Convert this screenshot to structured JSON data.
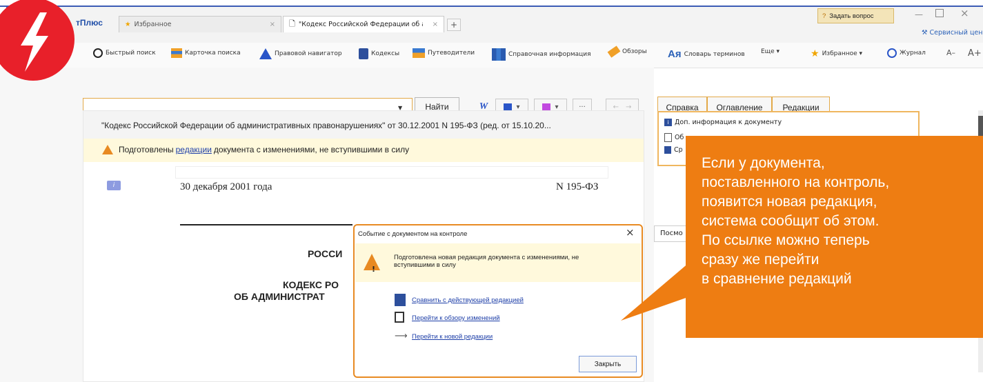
{
  "tabs": [
    {
      "label": "тПлюс"
    },
    {
      "label": "Избранное"
    },
    {
      "label": "\"Кодекс Российской Федерации об а..."
    }
  ],
  "header": {
    "ask_label": "Задать вопрос",
    "service_label": "Сервисный цен"
  },
  "toolbar": {
    "items": [
      {
        "label": "Быстрый поиск",
        "icon": "magnifier-icon"
      },
      {
        "label": "Карточка поиска",
        "icon": "search-card-icon"
      },
      {
        "label": "Правовой навигатор",
        "icon": "navigator-icon"
      },
      {
        "label": "Кодексы",
        "icon": "codex-icon"
      },
      {
        "label": "Путеводители",
        "icon": "signpost-icon"
      },
      {
        "label": "Справочная информация",
        "icon": "reference-icon"
      },
      {
        "label": "Обзоры",
        "icon": "pen-icon"
      },
      {
        "label": "Словарь терминов",
        "icon": "dictionary-icon"
      },
      {
        "label": "Еще ▾",
        "icon": ""
      }
    ],
    "favorites": "Избранное ▾",
    "journal": "Журнал",
    "font_small": "A–",
    "font_big": "A+"
  },
  "search": {
    "value": "",
    "find_label": "Найти"
  },
  "tool_buttons": [
    "W",
    "▾",
    "▾",
    "···",
    "←",
    "→"
  ],
  "side_tabs": [
    "Справка",
    "Оглавление",
    "Редакции"
  ],
  "document": {
    "title": "\"Кодекс Российской Федерации об административных правонарушениях\" от 30.12.2001 N 195-ФЗ (ред. от 15.10.20...",
    "notice_before": "Подготовлены ",
    "notice_link": "редакции",
    "notice_after": " документа с изменениями, не вступившими в силу",
    "date": "30 декабря 2001 года",
    "number": "N 195-ФЗ",
    "heading1": "РОССИ",
    "heading2": "КОДЕКС РО",
    "heading3": "ОБ АДМИНИСТРАТ"
  },
  "info_panel": {
    "items": [
      "Доп. информация к документу",
      "Об",
      "Ср"
    ],
    "peek": "Посмо"
  },
  "dialog": {
    "title": "Событие с документом на контроле",
    "message": "Подготовлена новая редакция документа с изменениями, не вступившими в силу",
    "links": [
      "Сравнить с действующей редакцией",
      "Перейти к обзору изменений",
      "Перейти к новой редакции"
    ],
    "close_label": "Закрыть"
  },
  "callout": {
    "lines": [
      "Если у документа,",
      "поставленного на контроль,",
      "появится новая редакция,",
      "система сообщит об этом.",
      "По ссылке можно теперь",
      "сразу же перейти",
      "в сравнение редакций"
    ]
  },
  "colors": {
    "accent": "#ee7d12",
    "badge": "#e8202a",
    "frame": "#3b5bb5",
    "link": "#1e3fa8"
  }
}
